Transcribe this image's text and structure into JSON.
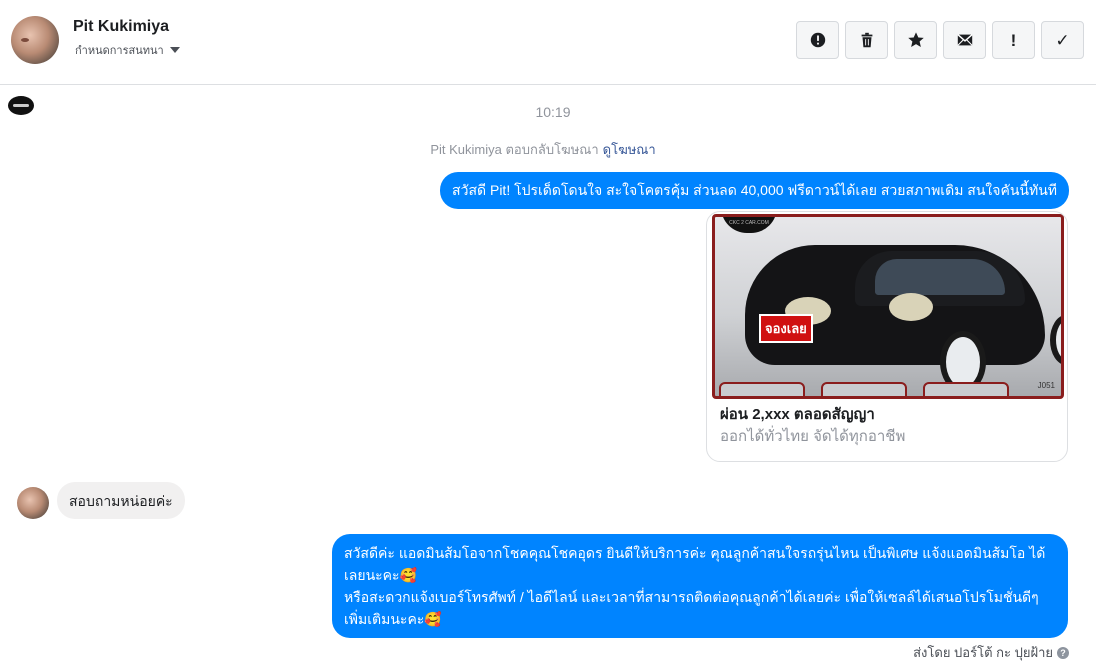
{
  "header": {
    "contact_name": "Pit Kukimiya",
    "label_dropdown": "กำหนดการสนทนา",
    "toolbar": [
      {
        "name": "spam-button",
        "icon": "alert-circle-icon"
      },
      {
        "name": "delete-button",
        "icon": "trash-icon"
      },
      {
        "name": "star-button",
        "icon": "star-icon"
      },
      {
        "name": "mark-unread-button",
        "icon": "envelope-icon"
      },
      {
        "name": "follow-up-button",
        "icon": "exclamation-icon",
        "glyph": "!"
      },
      {
        "name": "mark-done-button",
        "icon": "check-icon",
        "glyph": "✓"
      }
    ]
  },
  "conversation": {
    "time": "10:19",
    "context_text": "Pit Kukimiya ตอบกลับโฆษณา",
    "context_link": "ดูโฆษณา",
    "message_1": "สวัสดี Pit! โปรเด็ดโดนใจ สะใจโคตรคุ้ม ส่วนลด 40,000 ฟรีดาวน์ได้เลย สวยสภาพเดิม สนใจคันนี้ทันที",
    "card": {
      "stamp": "จองเลย",
      "code": "J051",
      "brand": "CKC 2 CAR.COM",
      "title": "ผ่อน 2,xxx ตลอดสัญญา",
      "subtitle": "ออกได้ทั่วไทย จัดได้ทุกอาชีพ"
    },
    "incoming_message": "สอบถามหน่อยค่ะ",
    "message_2_line1": "สวัสดีค่ะ แอดมินส้มโอจากโชคคุณโชคอุดร ยินดีให้บริการค่ะ   คุณลูกค้าสนใจรถรุ่นไหน เป็นพิเศษ แจ้งแอดมินส้มโอ ได้เลยนะคะ🥰",
    "message_2_line2": "หรือสะดวกแจ้งเบอร์โทรศัพท์ / ไอดีไลน์ และเวลาที่สามารถติดต่อคุณลูกค้าได้เลยค่ะ เพื่อให้เซลล์ได้เสนอโปรโมชั่นดีๆเพิ่มเติมนะคะ🥰",
    "sent_by": "ส่งโดย ปอร์โต้ กะ ปุยฝ้าย",
    "help_glyph": "?"
  },
  "colors": {
    "outgoing_bubble": "#0084ff",
    "incoming_bubble": "#f1f0f0",
    "link": "#385898"
  }
}
